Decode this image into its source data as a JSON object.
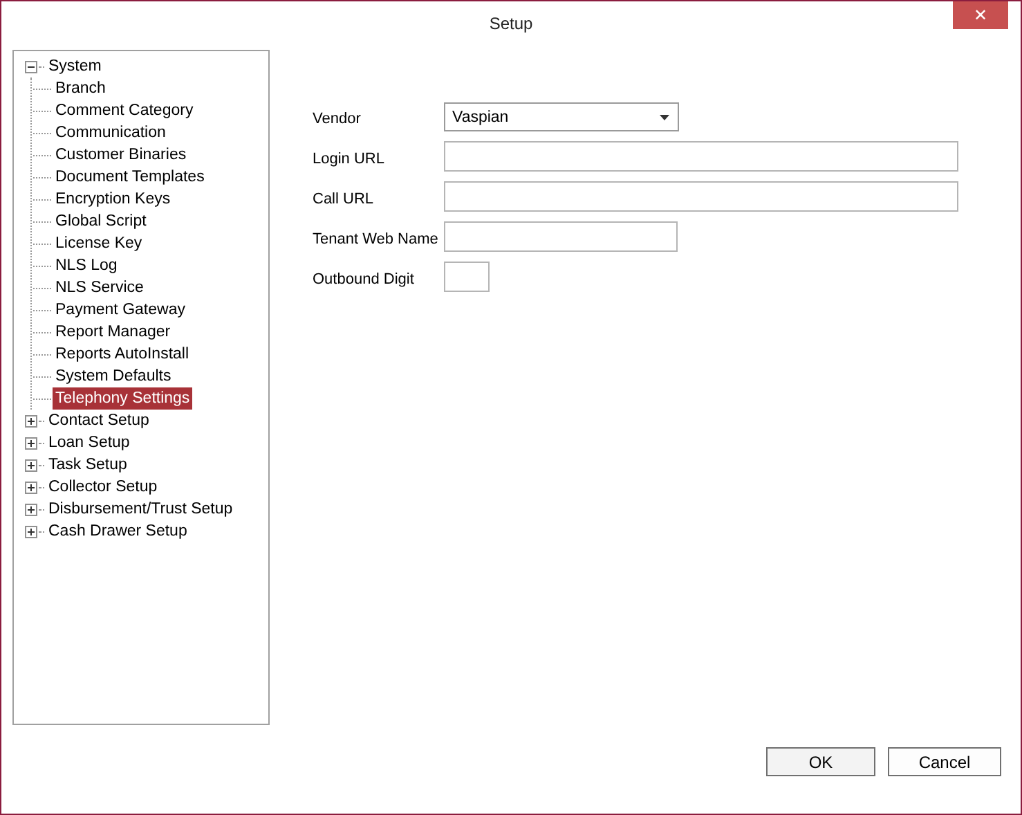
{
  "window": {
    "title": "Setup",
    "close": "✕"
  },
  "tree": [
    {
      "label": "System",
      "expanded": true,
      "children": [
        {
          "label": "Branch",
          "selected": false
        },
        {
          "label": "Comment Category",
          "selected": false
        },
        {
          "label": "Communication",
          "selected": false
        },
        {
          "label": "Customer Binaries",
          "selected": false
        },
        {
          "label": "Document Templates",
          "selected": false
        },
        {
          "label": "Encryption Keys",
          "selected": false
        },
        {
          "label": "Global Script",
          "selected": false
        },
        {
          "label": "License Key",
          "selected": false
        },
        {
          "label": "NLS Log",
          "selected": false
        },
        {
          "label": "NLS Service",
          "selected": false
        },
        {
          "label": "Payment Gateway",
          "selected": false
        },
        {
          "label": "Report Manager",
          "selected": false
        },
        {
          "label": "Reports AutoInstall",
          "selected": false
        },
        {
          "label": "System Defaults",
          "selected": false
        },
        {
          "label": "Telephony Settings",
          "selected": true
        }
      ]
    },
    {
      "label": "Contact Setup",
      "expanded": false
    },
    {
      "label": "Loan Setup",
      "expanded": false
    },
    {
      "label": "Task Setup",
      "expanded": false
    },
    {
      "label": "Collector Setup",
      "expanded": false
    },
    {
      "label": "Disbursement/Trust Setup",
      "expanded": false
    },
    {
      "label": "Cash Drawer Setup",
      "expanded": false
    }
  ],
  "form": [
    {
      "label": "Vendor",
      "kind": "select",
      "value": "Vaspian"
    },
    {
      "label": "Login URL",
      "kind": "text"
    },
    {
      "label": "Call URL",
      "kind": "text"
    },
    {
      "label": "Tenant Web Name",
      "kind": "text"
    },
    {
      "label": "Outbound Digit",
      "kind": "text"
    }
  ],
  "buttons": [
    "OK",
    "Cancel"
  ]
}
